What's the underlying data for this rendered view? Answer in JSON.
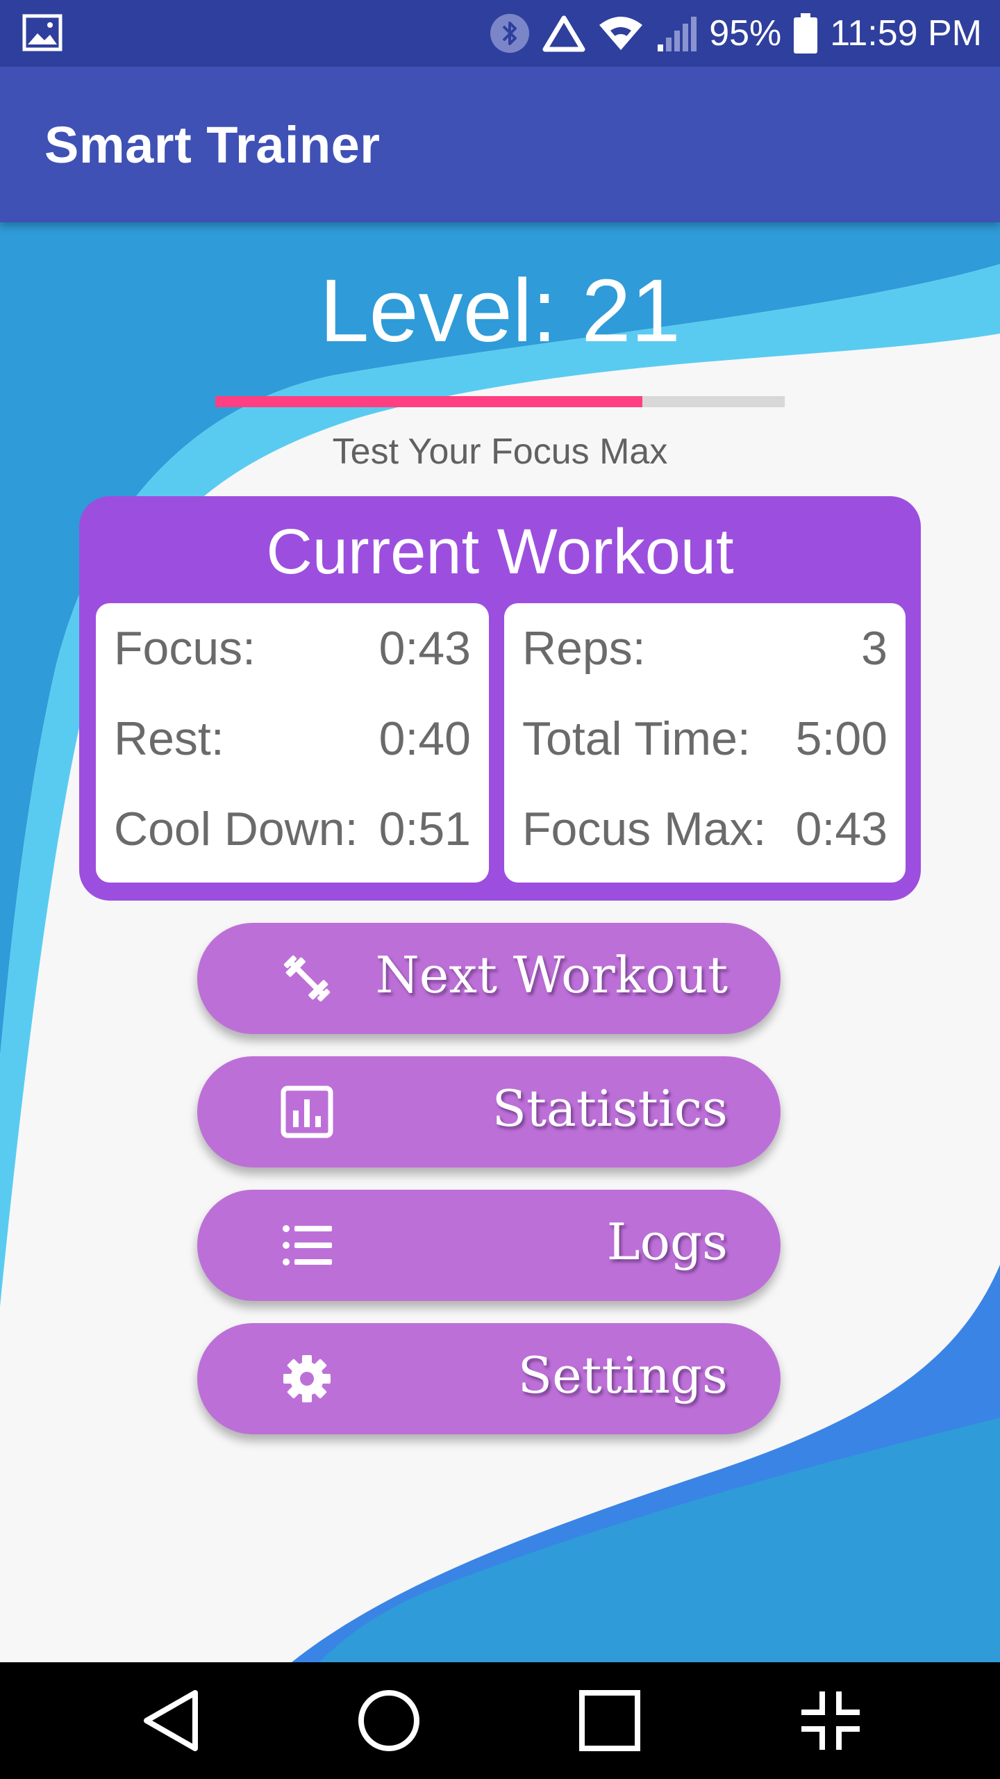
{
  "status_bar": {
    "left_icon": "image-icon",
    "icons": [
      "bluetooth-icon",
      "triangle-warning-icon",
      "wifi-icon",
      "signal-icon",
      "battery-icon"
    ],
    "battery": "95%",
    "time": "11:59 PM"
  },
  "app_bar": {
    "title": "Smart Trainer"
  },
  "level": {
    "title": "Level: 21",
    "progress_fraction": 0.75,
    "progress_color": "#ff3f81",
    "caption": "Test Your Focus Max"
  },
  "workout": {
    "title": "Current Workout",
    "left_stats": [
      {
        "label": "Focus:",
        "value": "0:43"
      },
      {
        "label": "Rest:",
        "value": "0:40"
      },
      {
        "label": "Cool Down:",
        "value": "0:51"
      }
    ],
    "right_stats": [
      {
        "label": "Reps:",
        "value": "3"
      },
      {
        "label": "Total Time:",
        "value": "5:00"
      },
      {
        "label": "Focus Max:",
        "value": "0:43"
      }
    ]
  },
  "menu": [
    {
      "label": "Next Workout",
      "icon": "dumbbell-icon"
    },
    {
      "label": "Statistics",
      "icon": "bar-chart-icon"
    },
    {
      "label": "Logs",
      "icon": "list-icon"
    },
    {
      "label": "Settings",
      "icon": "gear-icon"
    }
  ],
  "nav_bar": {
    "buttons": [
      "back-icon",
      "home-icon",
      "recent-apps-icon",
      "collapse-icon"
    ]
  },
  "colors": {
    "status_bar": "#2f3f9d",
    "app_bar": "#3f51b5",
    "card": "#9c4fde",
    "button": "#bd6fd8",
    "wave_dark": "#2f9bd8",
    "wave_light": "#5acbf0",
    "wave_bottom": "#3a84e6"
  }
}
